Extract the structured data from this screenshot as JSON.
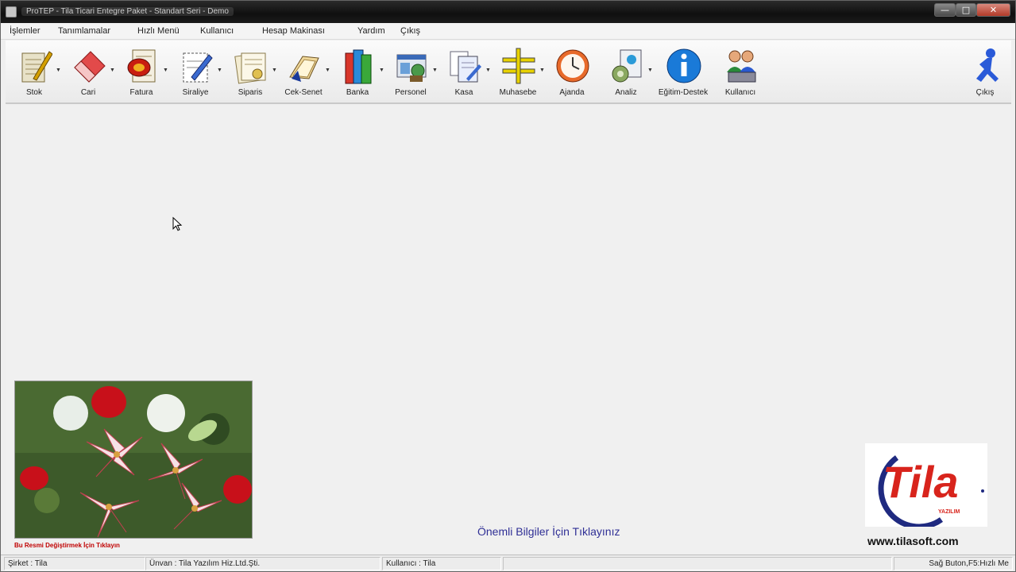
{
  "window": {
    "title": "ProTEP - Tila Ticari Entegre Paket - Standart Seri - Demo",
    "controls": {
      "minimize": "—",
      "maximize": "□",
      "close": "✕"
    }
  },
  "menu": {
    "items": [
      {
        "label": "İşlemler"
      },
      {
        "label": "Tanımlamalar"
      },
      {
        "label": "Hızlı Menü"
      },
      {
        "label": "Kullanıcı"
      },
      {
        "label": "Hesap Makinası"
      },
      {
        "label": "Yardım"
      },
      {
        "label": "Çıkış"
      }
    ]
  },
  "toolbar": {
    "items": [
      {
        "label": "Stok",
        "icon": "stock-pad-icon"
      },
      {
        "label": "Cari",
        "icon": "eraser-icon"
      },
      {
        "label": "Fatura",
        "icon": "invoice-stamp-icon"
      },
      {
        "label": "Siraliye",
        "icon": "order-pen-icon"
      },
      {
        "label": "Siparis",
        "icon": "order-document-icon"
      },
      {
        "label": "Cek-Senet",
        "icon": "cheque-book-icon"
      },
      {
        "label": "Banka",
        "icon": "bank-books-icon"
      },
      {
        "label": "Personel",
        "icon": "personnel-icon"
      },
      {
        "label": "Kasa",
        "icon": "cash-documents-icon"
      },
      {
        "label": "Muhasebe",
        "icon": "accounting-ledger-icon"
      },
      {
        "label": "Ajanda",
        "icon": "clock-icon"
      },
      {
        "label": "Analiz",
        "icon": "analysis-icon"
      },
      {
        "label": "Eğitim-Destek",
        "icon": "info-icon"
      },
      {
        "label": "Kullanıcı",
        "icon": "users-icon"
      }
    ],
    "exit": {
      "label": "Çıkış",
      "icon": "running-man-icon"
    }
  },
  "main": {
    "photo_caption": "Bu Resmi Değiştirmek İçin Tıklayın",
    "info_link": "Önemli Bilgiler İçin Tıklayınız",
    "logo_text": "Tila",
    "logo_subtext": "YAZILIM",
    "site_url": "www.tilasoft.com"
  },
  "status": {
    "company": "Şirket : Tila",
    "title_field": "Ünvan : Tila Yazılım Hiz.Ltd.Şti.",
    "user": "Kullanıcı : Tila",
    "hint": "Sağ Buton,F5:Hızlı Me"
  },
  "colors": {
    "logo_red": "#d8241c",
    "logo_navy": "#1f2a80",
    "link_blue": "#2f2f95",
    "caption_red": "#c00000"
  }
}
